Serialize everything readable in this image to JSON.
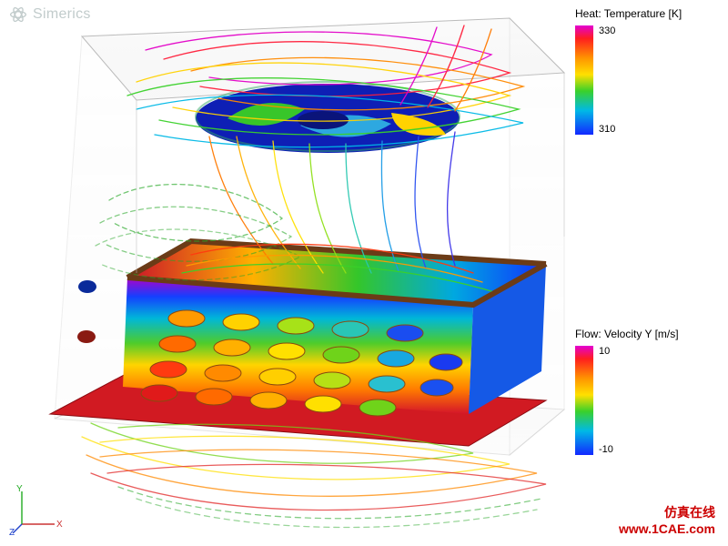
{
  "brand": {
    "name": "Simerics"
  },
  "legend_temp": {
    "title": "Heat: Temperature [K]",
    "max": "330",
    "min": "310"
  },
  "legend_vel": {
    "title": "Flow: Velocity Y [m/s]",
    "max": "10",
    "min": "-10"
  },
  "axes": {
    "x": "X",
    "y": "Y",
    "z": "Z"
  },
  "watermark": {
    "line1": "仿真在线",
    "line2": "www.1CAE.com"
  },
  "chart_data": {
    "type": "heatmap",
    "title": "CFD thermal/velocity field with streamlines over perforated heat-exchanger box",
    "legends": [
      {
        "name": "Heat: Temperature",
        "unit": "K",
        "range": [
          310,
          330
        ],
        "colormap": "rainbow"
      },
      {
        "name": "Flow: Velocity Y",
        "unit": "m/s",
        "range": [
          -10,
          10
        ],
        "colormap": "rainbow"
      }
    ],
    "axes": [
      "X",
      "Y",
      "Z"
    ]
  }
}
